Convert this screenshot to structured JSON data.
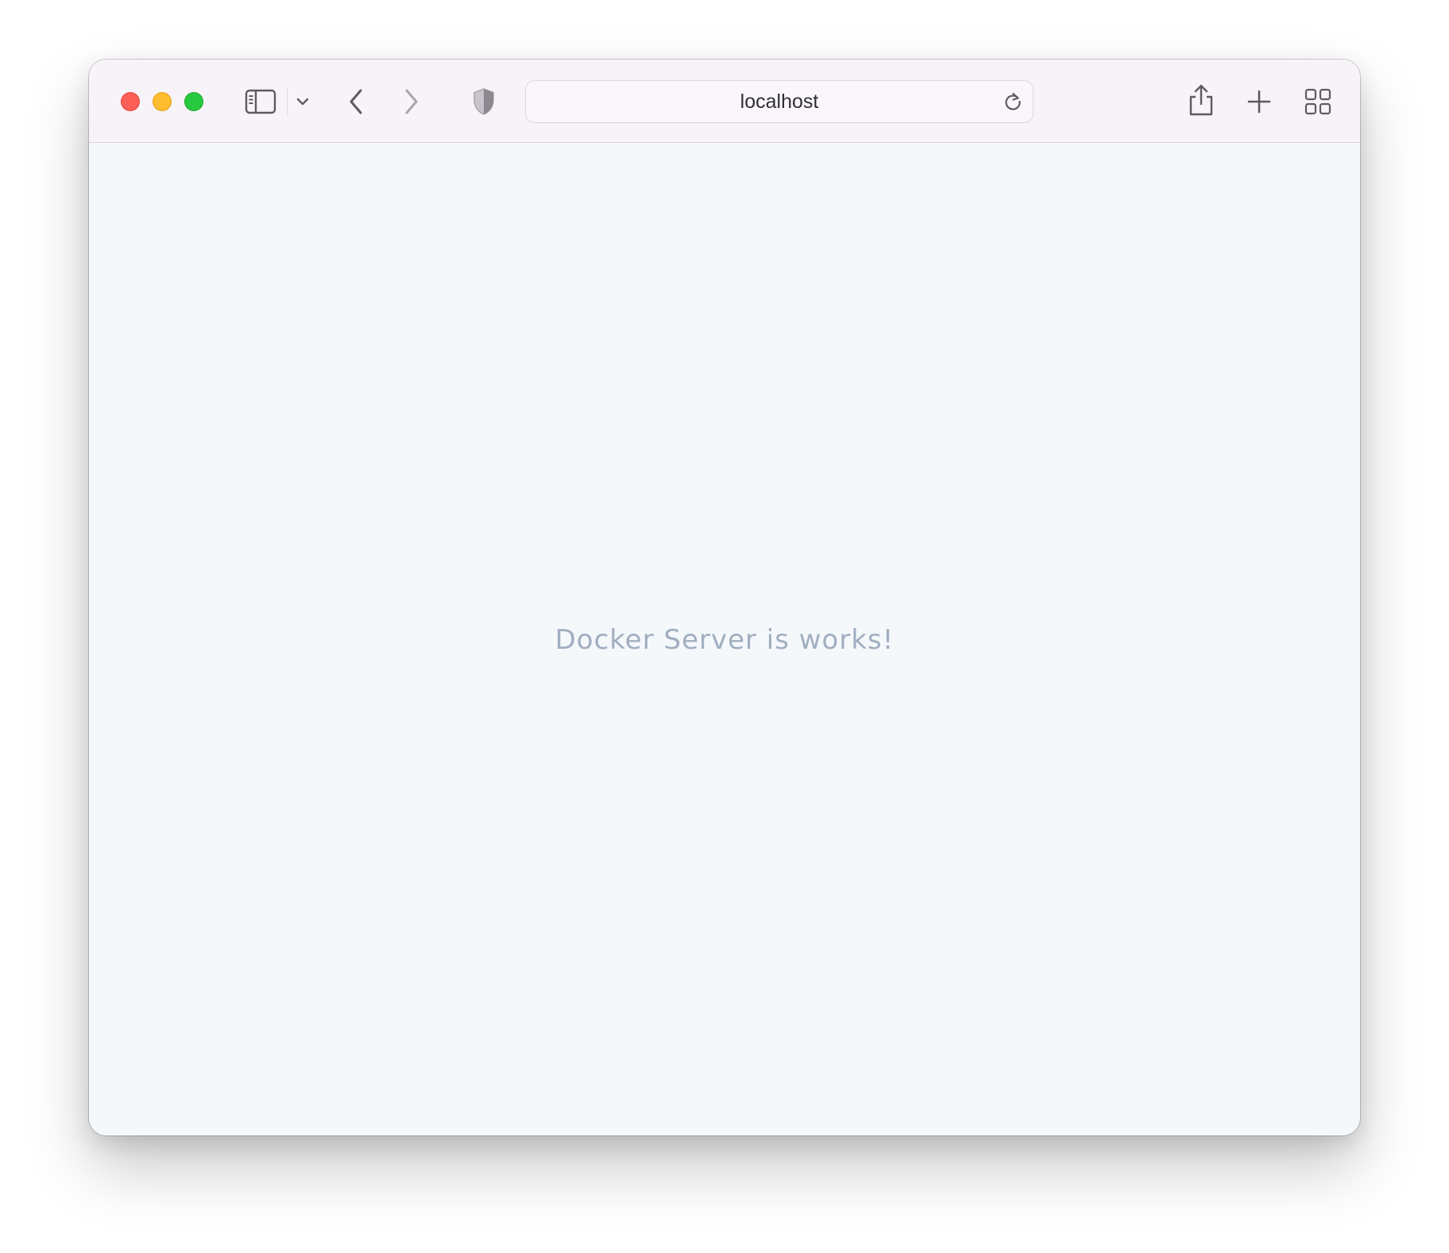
{
  "browser": {
    "address_bar": {
      "url": "localhost"
    },
    "icons": {
      "sidebar": "sidebar-icon",
      "tab_groups": "chevron-down-icon",
      "back": "chevron-left-icon",
      "forward": "chevron-right-icon",
      "privacy": "shield-icon",
      "reload": "reload-icon",
      "share": "share-icon",
      "new_tab": "plus-icon",
      "tab_overview": "grid-icon"
    },
    "colors": {
      "close": "#fe5f57",
      "minimize": "#febc2e",
      "maximize": "#28c840",
      "toolbar": "#f8f3f8",
      "page_background": "#f5f8fb",
      "message_text": "#a0aec0"
    }
  },
  "page": {
    "message": "Docker Server is works!"
  }
}
